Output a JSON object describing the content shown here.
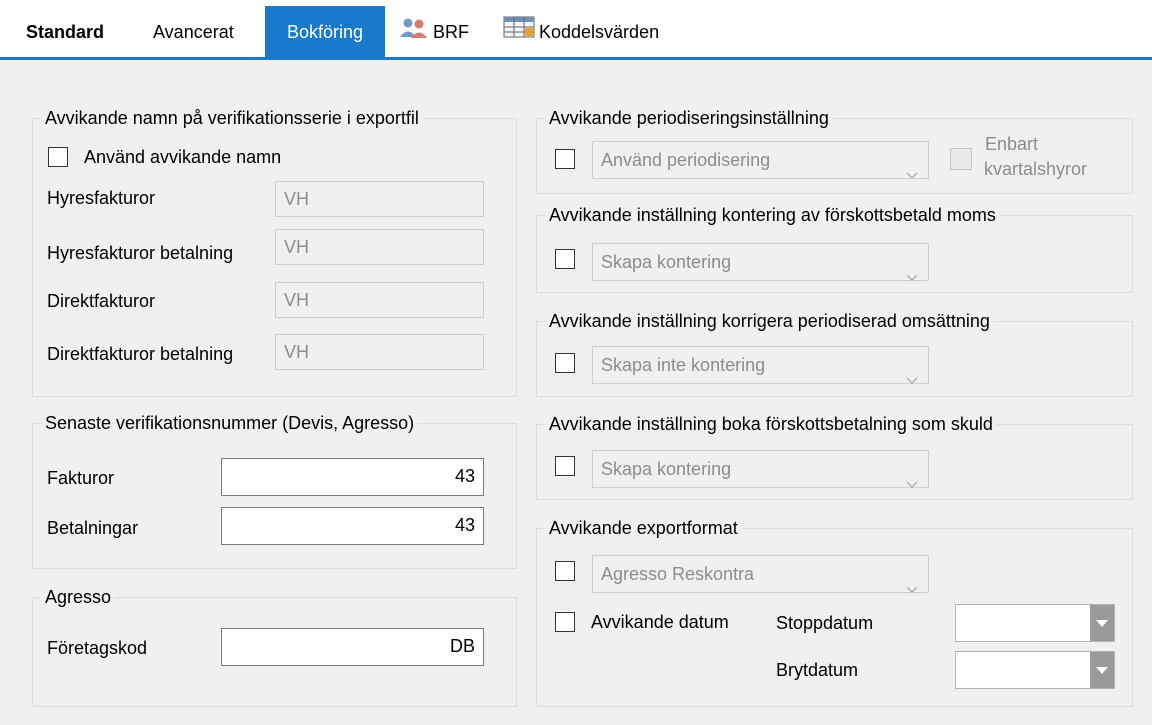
{
  "tabs": [
    {
      "label": "Standard"
    },
    {
      "label": "Avancerat"
    },
    {
      "label": "Bokföring"
    },
    {
      "label": "BRF"
    },
    {
      "label": "Koddelsvärden"
    }
  ],
  "left": {
    "series": {
      "legend": "Avvikande namn på verifikationsserie i exportfil",
      "checkbox_label": "Använd avvikande namn",
      "rows": [
        {
          "label": "Hyresfakturor",
          "value": "VH"
        },
        {
          "label": "Hyresfakturor betalning",
          "value": "VH"
        },
        {
          "label": "Direktfakturor",
          "value": "VH"
        },
        {
          "label": "Direktfakturor betalning",
          "value": "VH"
        }
      ]
    },
    "latest": {
      "legend": "Senaste verifikationsnummer (Devis, Agresso)",
      "rows": [
        {
          "label": "Fakturor",
          "value": "43"
        },
        {
          "label": "Betalningar",
          "value": "43"
        }
      ]
    },
    "agresso": {
      "legend": "Agresso",
      "company_label": "Företagskod",
      "company_value": "DB"
    }
  },
  "right": {
    "periodization": {
      "legend": "Avvikande periodiseringsinställning",
      "combo": "Använd periodisering",
      "quarter_label_1": "Enbart",
      "quarter_label_2": "kvartalshyror"
    },
    "prepaid_vat": {
      "legend": "Avvikande inställning kontering av förskottsbetald moms",
      "combo": "Skapa kontering"
    },
    "correct_turnover": {
      "legend": "Avvikande inställning korrigera periodiserad omsättning",
      "combo": "Skapa inte kontering"
    },
    "prepayment_debt": {
      "legend": "Avvikande inställning boka förskottsbetalning som skuld",
      "combo": "Skapa kontering"
    },
    "export_format": {
      "legend": "Avvikande exportformat",
      "combo": "Agresso Reskontra",
      "date_checkbox_label": "Avvikande datum",
      "stop_label": "Stoppdatum",
      "break_label": "Brytdatum"
    }
  }
}
